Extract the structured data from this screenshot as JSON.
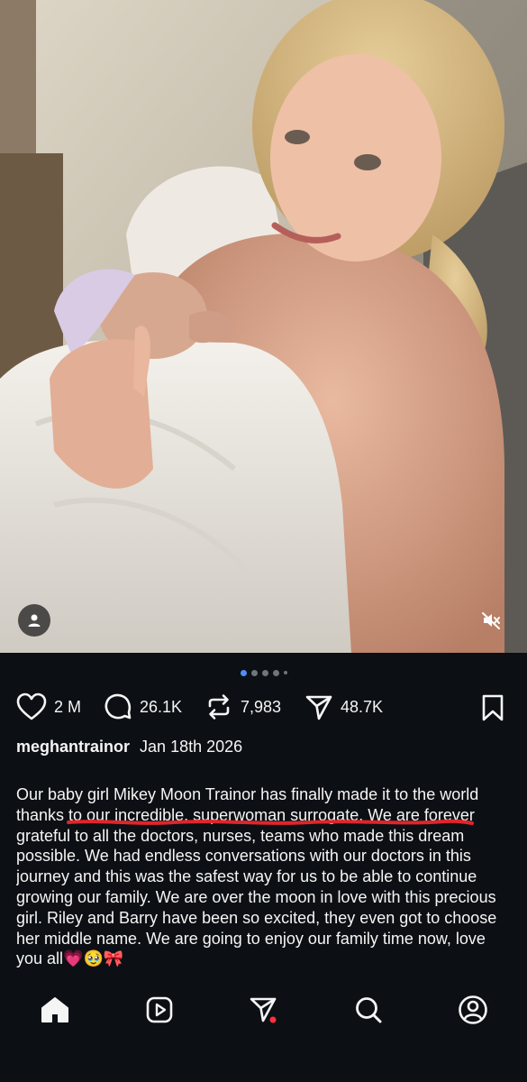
{
  "post": {
    "likes": "2 M",
    "comments": "26.1K",
    "reposts": "7,983",
    "shares": "48.7K",
    "author": "meghantrainor",
    "date": "Jan 18th 2026",
    "caption": "Our baby girl Mikey Moon Trainor has finally made it to the world thanks to our incredible, superwoman surrogate. We are forever grateful to all the doctors, nurses, teams who made this dream possible. We had endless conversations with our doctors in this journey and this was the safest way for us to be able to continue growing our family. We are over the moon in love with this precious girl. Riley and Barry have been so excited, they even got to choose her middle name. We are going to enjoy our family time now, love you all💗🥹🎀"
  },
  "carousel": {
    "total_dots": 5,
    "active_index": 0
  },
  "colors": {
    "background": "#0c1014",
    "text": "#f5f5f5",
    "active_dot": "#4f8ef7",
    "notification_dot": "#ff3040",
    "annotation_underline": "#e0252a"
  },
  "icons": {
    "like": "heart-icon",
    "comment": "comment-icon",
    "repost": "repost-icon",
    "share": "send-icon",
    "save": "bookmark-icon",
    "tag": "user-icon",
    "mute": "muted-speaker-icon",
    "nav": [
      "home-icon",
      "reels-icon",
      "messages-icon",
      "search-icon",
      "profile-icon"
    ]
  }
}
